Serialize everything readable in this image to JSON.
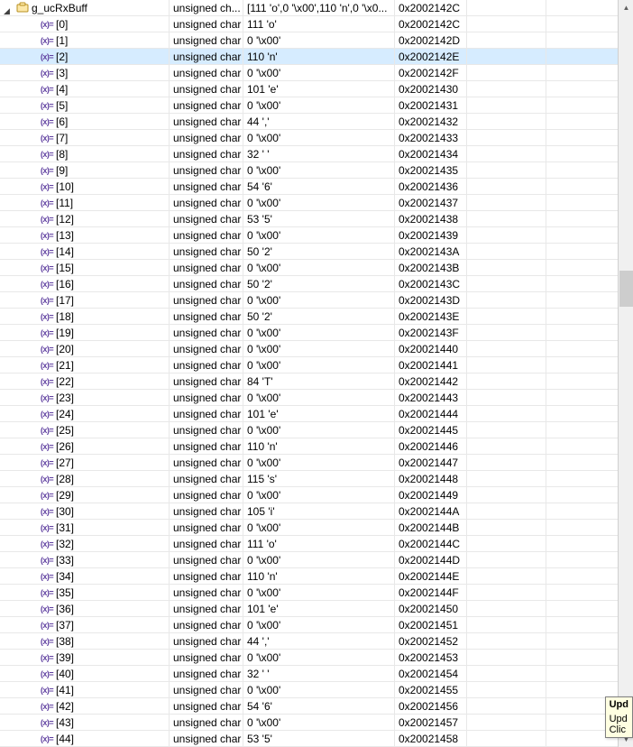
{
  "root": {
    "name": "g_ucRxBuff",
    "type": "unsigned ch...",
    "value": "[111 'o',0 '\\x00',110 'n',0 '\\x0...",
    "location": "0x2002142C"
  },
  "children": [
    {
      "idx": "[0]",
      "type": "unsigned char",
      "value": "111 'o'",
      "location": "0x2002142C"
    },
    {
      "idx": "[1]",
      "type": "unsigned char",
      "value": "0 '\\x00'",
      "location": "0x2002142D"
    },
    {
      "idx": "[2]",
      "type": "unsigned char",
      "value": "110 'n'",
      "location": "0x2002142E",
      "selected": true
    },
    {
      "idx": "[3]",
      "type": "unsigned char",
      "value": "0 '\\x00'",
      "location": "0x2002142F"
    },
    {
      "idx": "[4]",
      "type": "unsigned char",
      "value": "101 'e'",
      "location": "0x20021430"
    },
    {
      "idx": "[5]",
      "type": "unsigned char",
      "value": "0 '\\x00'",
      "location": "0x20021431"
    },
    {
      "idx": "[6]",
      "type": "unsigned char",
      "value": "44 ','",
      "location": "0x20021432"
    },
    {
      "idx": "[7]",
      "type": "unsigned char",
      "value": "0 '\\x00'",
      "location": "0x20021433"
    },
    {
      "idx": "[8]",
      "type": "unsigned char",
      "value": "32 ' '",
      "location": "0x20021434"
    },
    {
      "idx": "[9]",
      "type": "unsigned char",
      "value": "0 '\\x00'",
      "location": "0x20021435"
    },
    {
      "idx": "[10]",
      "type": "unsigned char",
      "value": "54 '6'",
      "location": "0x20021436"
    },
    {
      "idx": "[11]",
      "type": "unsigned char",
      "value": "0 '\\x00'",
      "location": "0x20021437"
    },
    {
      "idx": "[12]",
      "type": "unsigned char",
      "value": "53 '5'",
      "location": "0x20021438"
    },
    {
      "idx": "[13]",
      "type": "unsigned char",
      "value": "0 '\\x00'",
      "location": "0x20021439"
    },
    {
      "idx": "[14]",
      "type": "unsigned char",
      "value": "50 '2'",
      "location": "0x2002143A"
    },
    {
      "idx": "[15]",
      "type": "unsigned char",
      "value": "0 '\\x00'",
      "location": "0x2002143B"
    },
    {
      "idx": "[16]",
      "type": "unsigned char",
      "value": "50 '2'",
      "location": "0x2002143C"
    },
    {
      "idx": "[17]",
      "type": "unsigned char",
      "value": "0 '\\x00'",
      "location": "0x2002143D"
    },
    {
      "idx": "[18]",
      "type": "unsigned char",
      "value": "50 '2'",
      "location": "0x2002143E"
    },
    {
      "idx": "[19]",
      "type": "unsigned char",
      "value": "0 '\\x00'",
      "location": "0x2002143F"
    },
    {
      "idx": "[20]",
      "type": "unsigned char",
      "value": "0 '\\x00'",
      "location": "0x20021440"
    },
    {
      "idx": "[21]",
      "type": "unsigned char",
      "value": "0 '\\x00'",
      "location": "0x20021441"
    },
    {
      "idx": "[22]",
      "type": "unsigned char",
      "value": "84 'T'",
      "location": "0x20021442"
    },
    {
      "idx": "[23]",
      "type": "unsigned char",
      "value": "0 '\\x00'",
      "location": "0x20021443"
    },
    {
      "idx": "[24]",
      "type": "unsigned char",
      "value": "101 'e'",
      "location": "0x20021444"
    },
    {
      "idx": "[25]",
      "type": "unsigned char",
      "value": "0 '\\x00'",
      "location": "0x20021445"
    },
    {
      "idx": "[26]",
      "type": "unsigned char",
      "value": "110 'n'",
      "location": "0x20021446"
    },
    {
      "idx": "[27]",
      "type": "unsigned char",
      "value": "0 '\\x00'",
      "location": "0x20021447"
    },
    {
      "idx": "[28]",
      "type": "unsigned char",
      "value": "115 's'",
      "location": "0x20021448"
    },
    {
      "idx": "[29]",
      "type": "unsigned char",
      "value": "0 '\\x00'",
      "location": "0x20021449"
    },
    {
      "idx": "[30]",
      "type": "unsigned char",
      "value": "105 'i'",
      "location": "0x2002144A"
    },
    {
      "idx": "[31]",
      "type": "unsigned char",
      "value": "0 '\\x00'",
      "location": "0x2002144B"
    },
    {
      "idx": "[32]",
      "type": "unsigned char",
      "value": "111 'o'",
      "location": "0x2002144C"
    },
    {
      "idx": "[33]",
      "type": "unsigned char",
      "value": "0 '\\x00'",
      "location": "0x2002144D"
    },
    {
      "idx": "[34]",
      "type": "unsigned char",
      "value": "110 'n'",
      "location": "0x2002144E"
    },
    {
      "idx": "[35]",
      "type": "unsigned char",
      "value": "0 '\\x00'",
      "location": "0x2002144F"
    },
    {
      "idx": "[36]",
      "type": "unsigned char",
      "value": "101 'e'",
      "location": "0x20021450"
    },
    {
      "idx": "[37]",
      "type": "unsigned char",
      "value": "0 '\\x00'",
      "location": "0x20021451"
    },
    {
      "idx": "[38]",
      "type": "unsigned char",
      "value": "44 ','",
      "location": "0x20021452"
    },
    {
      "idx": "[39]",
      "type": "unsigned char",
      "value": "0 '\\x00'",
      "location": "0x20021453"
    },
    {
      "idx": "[40]",
      "type": "unsigned char",
      "value": "32 ' '",
      "location": "0x20021454"
    },
    {
      "idx": "[41]",
      "type": "unsigned char",
      "value": "0 '\\x00'",
      "location": "0x20021455"
    },
    {
      "idx": "[42]",
      "type": "unsigned char",
      "value": "54 '6'",
      "location": "0x20021456"
    },
    {
      "idx": "[43]",
      "type": "unsigned char",
      "value": "0 '\\x00'",
      "location": "0x20021457"
    },
    {
      "idx": "[44]",
      "type": "unsigned char",
      "value": "53 '5'",
      "location": "0x20021458"
    }
  ],
  "tooltip": {
    "title": "Upd",
    "line1": "Upd",
    "line2": "Clic"
  }
}
